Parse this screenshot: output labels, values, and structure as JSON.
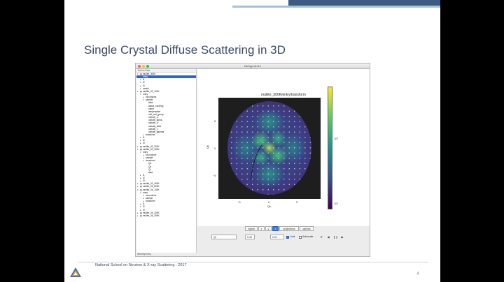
{
  "slide": {
    "title": "Single Crystal Diffuse Scattering in 3D",
    "footer": "National School on Neutron & X-ray Scattering - 2017",
    "page_number": "4"
  },
  "window": {
    "title": "NeXpy v0.8.1"
  },
  "tree": {
    "header": "NeXus Data",
    "status": "NXentry:entry",
    "rows": [
      {
        "label": "mullite_300K",
        "indent": 0,
        "arrow": "▾",
        "icon": true,
        "selected": false
      },
      {
        "label": "entry",
        "indent": 1,
        "arrow": "",
        "icon": false,
        "selected": true
      },
      {
        "label": "f1",
        "indent": 1,
        "arrow": "▸",
        "icon": false,
        "selected": false
      },
      {
        "label": "f2",
        "indent": 1,
        "arrow": "▸",
        "icon": false,
        "selected": false
      },
      {
        "label": "f3",
        "indent": 1,
        "arrow": "▸",
        "icon": false,
        "selected": false
      },
      {
        "label": "model",
        "indent": 1,
        "arrow": "▸",
        "icon": false,
        "selected": false
      },
      {
        "label": "mullite_02_100K",
        "indent": 0,
        "arrow": "▾",
        "icon": true,
        "selected": false
      },
      {
        "label": "entry",
        "indent": 1,
        "arrow": "▾",
        "icon": false,
        "selected": false
      },
      {
        "label": "nxcombine",
        "indent": 2,
        "arrow": "▸",
        "icon": false,
        "selected": false
      },
      {
        "label": "sample",
        "indent": 2,
        "arrow": "▾",
        "icon": false,
        "selected": false
      },
      {
        "label": "label",
        "indent": 3,
        "arrow": "",
        "icon": false,
        "selected": false
      },
      {
        "label": "lattice_centring",
        "indent": 3,
        "arrow": "",
        "icon": false,
        "selected": false
      },
      {
        "label": "name",
        "indent": 3,
        "arrow": "",
        "icon": false,
        "selected": false
      },
      {
        "label": "temperature",
        "indent": 3,
        "arrow": "",
        "icon": false,
        "selected": false
      },
      {
        "label": "unit_cell_group",
        "indent": 3,
        "arrow": "",
        "icon": false,
        "selected": false
      },
      {
        "label": "unitcell_a",
        "indent": 3,
        "arrow": "",
        "icon": false,
        "selected": false
      },
      {
        "label": "unitcell_alpha",
        "indent": 3,
        "arrow": "",
        "icon": false,
        "selected": false
      },
      {
        "label": "unitcell_b",
        "indent": 3,
        "arrow": "",
        "icon": false,
        "selected": false
      },
      {
        "label": "unitcell_beta",
        "indent": 3,
        "arrow": "",
        "icon": false,
        "selected": false
      },
      {
        "label": "unitcell_c",
        "indent": 3,
        "arrow": "",
        "icon": false,
        "selected": false
      },
      {
        "label": "unitcell_gamma",
        "indent": 3,
        "arrow": "",
        "icon": false,
        "selected": false
      },
      {
        "label": "transform",
        "indent": 2,
        "arrow": "▸",
        "icon": false,
        "selected": false
      },
      {
        "label": "f1",
        "indent": 1,
        "arrow": "▸",
        "icon": false,
        "selected": false
      },
      {
        "label": "f2",
        "indent": 1,
        "arrow": "▸",
        "icon": false,
        "selected": false
      },
      {
        "label": "f3",
        "indent": 1,
        "arrow": "▸",
        "icon": false,
        "selected": false
      },
      {
        "label": "mullite_02_200K",
        "indent": 0,
        "arrow": "▸",
        "icon": true,
        "selected": false
      },
      {
        "label": "mullite_02_300K",
        "indent": 0,
        "arrow": "▾",
        "icon": true,
        "selected": false
      },
      {
        "label": "entry",
        "indent": 1,
        "arrow": "▾",
        "icon": false,
        "selected": false
      },
      {
        "label": "nxcombine",
        "indent": 2,
        "arrow": "▸",
        "icon": false,
        "selected": false
      },
      {
        "label": "sample",
        "indent": 2,
        "arrow": "▸",
        "icon": false,
        "selected": false
      },
      {
        "label": "transform",
        "indent": 2,
        "arrow": "▾",
        "icon": false,
        "selected": false
      },
      {
        "label": "Qh",
        "indent": 3,
        "arrow": "",
        "icon": false,
        "selected": false
      },
      {
        "label": "Qk",
        "indent": 3,
        "arrow": "",
        "icon": false,
        "selected": false
      },
      {
        "label": "Ql",
        "indent": 3,
        "arrow": "",
        "icon": false,
        "selected": false
      },
      {
        "label": "data",
        "indent": 3,
        "arrow": "",
        "icon": false,
        "selected": false
      },
      {
        "label": "f1",
        "indent": 1,
        "arrow": "▸",
        "icon": false,
        "selected": false
      },
      {
        "label": "f2",
        "indent": 1,
        "arrow": "▸",
        "icon": false,
        "selected": false
      },
      {
        "label": "f3",
        "indent": 1,
        "arrow": "▸",
        "icon": false,
        "selected": false
      },
      {
        "label": "mullite_02_400K",
        "indent": 0,
        "arrow": "▸",
        "icon": true,
        "selected": false
      },
      {
        "label": "mullite_02_500K",
        "indent": 0,
        "arrow": "▸",
        "icon": true,
        "selected": false
      },
      {
        "label": "mullite_04_100K",
        "indent": 0,
        "arrow": "▾",
        "icon": true,
        "selected": false
      },
      {
        "label": "entry",
        "indent": 1,
        "arrow": "▾",
        "icon": false,
        "selected": false
      },
      {
        "label": "nxcombine",
        "indent": 2,
        "arrow": "▸",
        "icon": false,
        "selected": false
      },
      {
        "label": "sample",
        "indent": 2,
        "arrow": "▸",
        "icon": false,
        "selected": false
      },
      {
        "label": "transform",
        "indent": 2,
        "arrow": "▸",
        "icon": false,
        "selected": false
      },
      {
        "label": "f1",
        "indent": 1,
        "arrow": "▸",
        "icon": false,
        "selected": false
      },
      {
        "label": "f2",
        "indent": 1,
        "arrow": "▸",
        "icon": false,
        "selected": false
      },
      {
        "label": "f3",
        "indent": 1,
        "arrow": "▸",
        "icon": false,
        "selected": false
      },
      {
        "label": "mullite_04_200K",
        "indent": 0,
        "arrow": "▸",
        "icon": true,
        "selected": false
      },
      {
        "label": "mullite_04_300K",
        "indent": 0,
        "arrow": "▸",
        "icon": true,
        "selected": false
      }
    ]
  },
  "plot": {
    "title": "mullite_300K/entry/transform",
    "ylabel": "Qk",
    "xlabel": "Qh",
    "xticks": [
      "−5",
      "0",
      "5"
    ],
    "yticks": [
      "5",
      "0",
      "−5"
    ],
    "colorbar_ticks": [
      "10³",
      "10²"
    ],
    "colormap": [
      "#440154",
      "#3b528b",
      "#21918c",
      "#5ec962",
      "#fde725"
    ]
  },
  "tabs": {
    "items": [
      "signal",
      "x",
      "y",
      "z",
      "projections",
      "options"
    ],
    "active_index": 3
  },
  "controls": {
    "axis_select": "Ql",
    "value": "0.49",
    "step": "0.01",
    "lock_label": "Lock",
    "lock_checked": true,
    "autoscale_label": "Autoscale",
    "autoscale_checked": false
  }
}
